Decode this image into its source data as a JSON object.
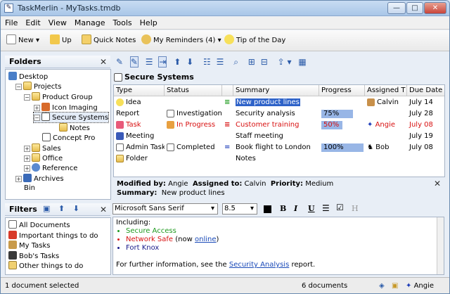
{
  "window": {
    "title": "TaskMerlin - MyTasks.tmdb",
    "minimize": "—",
    "maximize": "□",
    "close": "✕"
  },
  "menu": [
    "File",
    "Edit",
    "View",
    "Manage",
    "Tools",
    "Help"
  ],
  "toolbar": {
    "new_label": "New",
    "up_label": "Up",
    "quick_notes_label": "Quick Notes",
    "my_reminders_label": "My Reminders (4)",
    "tip_label": "Tip of the Day"
  },
  "folders": {
    "title": "Folders",
    "items": [
      {
        "label": "Desktop"
      },
      {
        "label": "Projects"
      },
      {
        "label": "Product Group"
      },
      {
        "label": "Icon Imaging"
      },
      {
        "label": "Secure Systems"
      },
      {
        "label": "Notes"
      },
      {
        "label": "Concept Pro"
      },
      {
        "label": "Sales"
      },
      {
        "label": "Office"
      },
      {
        "label": "Reference"
      },
      {
        "label": "Archives"
      },
      {
        "label": "Bin"
      }
    ]
  },
  "filters": {
    "title": "Filters",
    "items": [
      {
        "label": "All Documents"
      },
      {
        "label": "Important things to do"
      },
      {
        "label": "My Tasks"
      },
      {
        "label": "Bob's Tasks"
      },
      {
        "label": "Other things to do"
      }
    ]
  },
  "main": {
    "title": "Secure Systems",
    "columns": [
      "Type",
      "Status",
      "Summary",
      "Progress",
      "Assigned T",
      "Due Date"
    ],
    "rows": [
      {
        "type": "Idea",
        "status": "",
        "summary": "New product lines",
        "progress": "",
        "assigned": "Calvin",
        "due": "July 14",
        "red": false
      },
      {
        "type": "Report",
        "status": "Investigation",
        "summary": "Security analysis",
        "progress": "75%",
        "assigned": "",
        "due": "July 28",
        "red": false
      },
      {
        "type": "Task",
        "status": "In Progress",
        "summary": "Customer training",
        "progress": "50%",
        "assigned": "Angie",
        "due": "July 08",
        "red": true
      },
      {
        "type": "Meeting",
        "status": "",
        "summary": "Staff meeting",
        "progress": "",
        "assigned": "",
        "due": "July 19",
        "red": false
      },
      {
        "type": "Admin Task",
        "status": "Completed",
        "summary": "Book flight to London",
        "progress": "100%",
        "assigned": "Bob",
        "due": "July 08",
        "red": false
      },
      {
        "type": "Folder",
        "status": "",
        "summary": "Notes",
        "progress": "",
        "assigned": "",
        "due": "",
        "red": false
      }
    ]
  },
  "details": {
    "modified_by_label": "Modified by:",
    "modified_by": "Angie",
    "assigned_to_label": "Assigned to:",
    "assigned_to": "Calvin",
    "priority_label": "Priority:",
    "priority": "Medium",
    "summary_label": "Summary:",
    "summary": "New product lines"
  },
  "format": {
    "font": "Microsoft Sans Serif",
    "size": "8.5",
    "bold": "B",
    "italic": "I",
    "underline": "U",
    "strike": "H"
  },
  "editor": {
    "intro": "Including:",
    "bullets": [
      {
        "text": "Secure Access",
        "color": "#1f9a1f"
      },
      {
        "text": "Network Safe",
        "color": "#d81010",
        "suffix_pre": " (now ",
        "link": "online",
        "suffix_post": ")"
      },
      {
        "text": "Fort Knox",
        "color": "#1a1a8a"
      }
    ],
    "footer_pre": "For further information, see the ",
    "footer_link": "Security Analysis",
    "footer_post": " report."
  },
  "status": {
    "selected": "1 document selected",
    "count": "6 documents",
    "user": "Angie"
  }
}
